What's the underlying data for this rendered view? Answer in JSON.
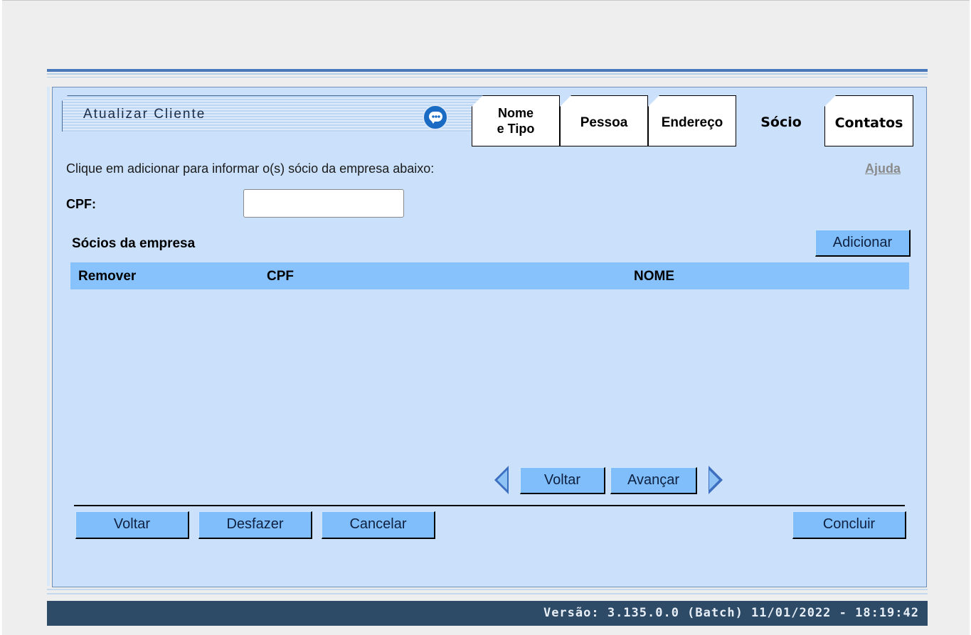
{
  "window": {
    "title": "Atualizar Cliente"
  },
  "tabs": [
    {
      "label": "Nome e Tipo"
    },
    {
      "label": "Pessoa"
    },
    {
      "label": "Endereço"
    },
    {
      "label": "Sócio"
    },
    {
      "label": "Contatos"
    }
  ],
  "tab_nome_line1": "Nome",
  "tab_nome_line2": "e Tipo",
  "active_tab": "Sócio",
  "instructions": "Clique em adicionar para informar o(s) sócio da empresa abaixo:",
  "help_link": "Ajuda",
  "cpf_field": {
    "label": "CPF:",
    "value": "",
    "placeholder": ""
  },
  "socios": {
    "title": "Sócios da empresa",
    "add_button": "Adicionar",
    "columns": [
      "Remover",
      "CPF",
      "NOME"
    ],
    "rows": []
  },
  "pagination": {
    "prev": "Voltar",
    "next": "Avançar"
  },
  "actions": {
    "back": "Voltar",
    "undo": "Desfazer",
    "cancel": "Cancelar",
    "finish": "Concluir"
  },
  "footer": {
    "version": "Versão: 3.135.0.0 (Batch) 11/01/2022 - 18:19:42"
  },
  "icons": {
    "chat": "chat-bubble-icon",
    "prev": "arrow-left-icon",
    "next": "arrow-right-icon"
  },
  "colors": {
    "panel": "#cbe1fb",
    "table_header": "#88c2fc",
    "button": "#7fbefb",
    "footer": "#2d4a67",
    "accent": "#4a79b9"
  }
}
